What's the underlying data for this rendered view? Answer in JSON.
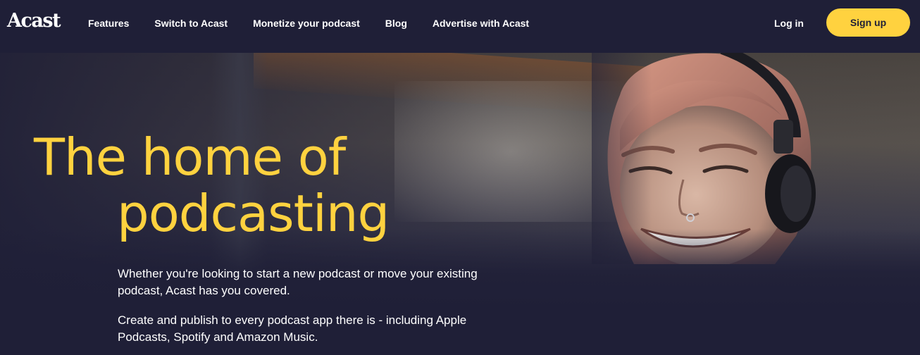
{
  "brand": {
    "logo": "Acast"
  },
  "nav": {
    "items": [
      {
        "label": "Features"
      },
      {
        "label": "Switch to Acast"
      },
      {
        "label": "Monetize your podcast"
      },
      {
        "label": "Blog"
      },
      {
        "label": "Advertise with Acast"
      }
    ],
    "login_label": "Log in",
    "signup_label": "Sign up"
  },
  "hero": {
    "headline_line1": "The home of",
    "headline_line2": "podcasting",
    "paragraph1": "Whether you're looking to start a new podcast or move your existing podcast, Acast has you covered.",
    "paragraph2": "Create and publish to every podcast app there is - including Apple Podcasts, Spotify and Amazon Music."
  },
  "colors": {
    "background": "#1f1f37",
    "accent": "#ffd23f",
    "text": "#ffffff"
  }
}
